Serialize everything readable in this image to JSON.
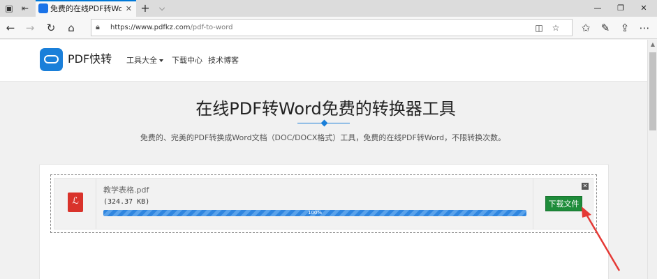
{
  "browser": {
    "tab_title": "免费的在线PDF转Word",
    "tab_close": "✕",
    "new_tab": "+",
    "tab_list": "⌵",
    "window_controls": {
      "minimize": "—",
      "restore": "❐",
      "close": "✕"
    },
    "url": {
      "host": "https://www.pdfkz.com",
      "path": "/pdf-to-word"
    },
    "nav_icons": [
      "back-icon",
      "forward-icon",
      "refresh-icon",
      "home-icon"
    ],
    "toolbar_icons": [
      "reading-view-icon",
      "favorite-star-icon",
      "favorites-hub-icon",
      "pen-icon",
      "share-icon",
      "more-icon"
    ]
  },
  "site": {
    "logo_name": "PDF快转",
    "nav": [
      {
        "label": "工具大全",
        "has_dropdown": true
      },
      {
        "label": "下载中心"
      },
      {
        "label": "技术博客"
      }
    ]
  },
  "hero": {
    "title": "在线PDF转Word免费的转换器工具",
    "description": "免费的、完美的PDF转换成Word文档（DOC/DOCX格式）工具，免费的在线PDF转Word，不限转换次数。"
  },
  "upload": {
    "file_name": "教学表格.pdf",
    "file_size": "(324.37 KB)",
    "progress_label": "100%",
    "progress_value": 1.0,
    "remove_label": "✕",
    "download_label": "下载文件"
  },
  "colors": {
    "accent": "#1a7fd9",
    "download_button": "#1e8c3a",
    "pdf_icon": "#d9332b",
    "annotation_arrow": "#e53935"
  }
}
